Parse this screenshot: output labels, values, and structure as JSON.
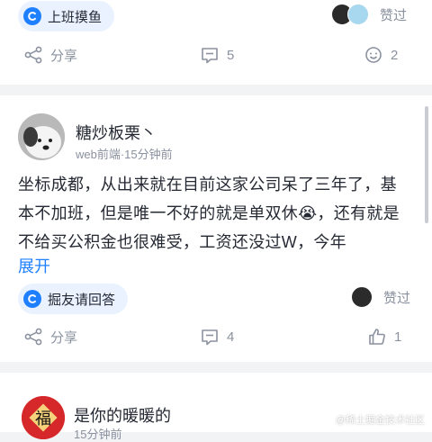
{
  "post1": {
    "tag": "上班摸鱼",
    "like_label": "赞过",
    "actions": {
      "share": "分享",
      "comments": "5",
      "reacts": "2"
    }
  },
  "post2": {
    "author": "糖炒板栗丶",
    "meta": "web前端·15分钟前",
    "content": "坐标成都，从出来就在目前这家公司呆了三年了，基本不加班，但是唯一不好的就是单双休😭，还有就是不给买公积金也很难受，工资还没过W，今年",
    "expand": "展开",
    "tag": "掘友请回答",
    "like_label": "赞过",
    "actions": {
      "share": "分享",
      "comments": "4",
      "likes": "1"
    }
  },
  "post3": {
    "author": "是你的暖暖的",
    "meta": "15分钟前",
    "avatar_char": "福"
  },
  "watermark": "@稀土掘金技术社区",
  "colors": {
    "accent": "#1e80ff",
    "muted": "#8a919f",
    "text": "#252933",
    "background": "#f2f3f5"
  }
}
